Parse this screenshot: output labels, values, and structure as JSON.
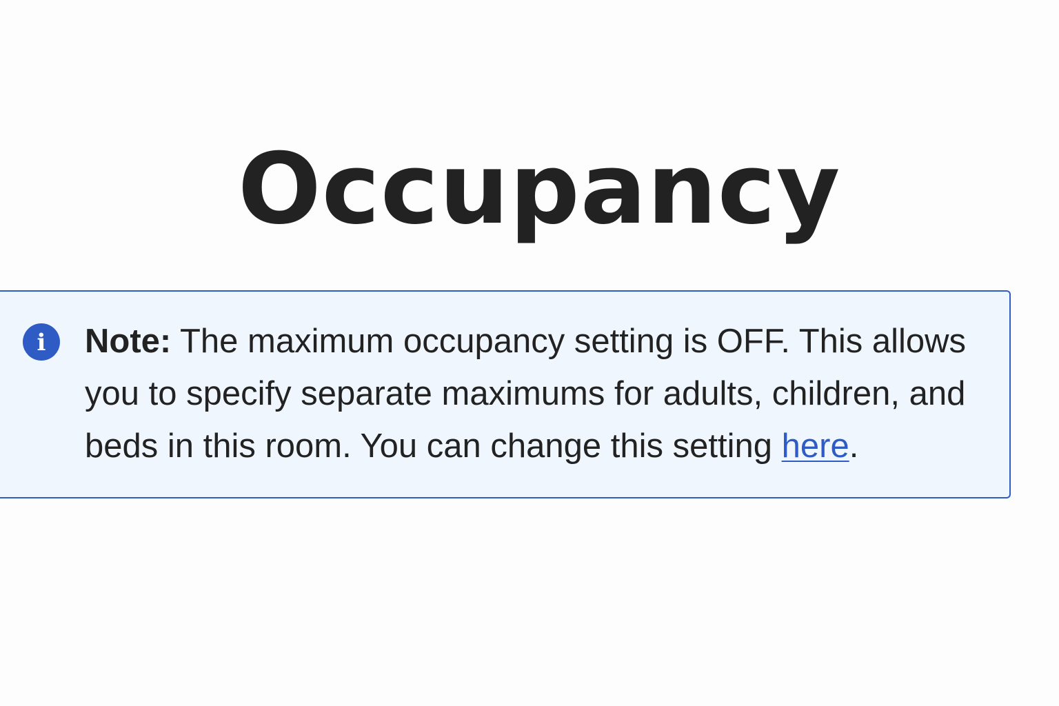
{
  "page": {
    "title": "Occupancy"
  },
  "note": {
    "label": "Note:",
    "message": "The maximum occupancy setting is OFF. This allows you to specify separate maximums for adults, children, and beds in this room. You can change this setting",
    "link_text": "here",
    "trailing_punctuation": ".",
    "icon": "info-icon",
    "icon_glyph": "i"
  },
  "colors": {
    "accent": "#2e5cc4",
    "callout_background": "#eff6fe",
    "text": "#222222"
  }
}
